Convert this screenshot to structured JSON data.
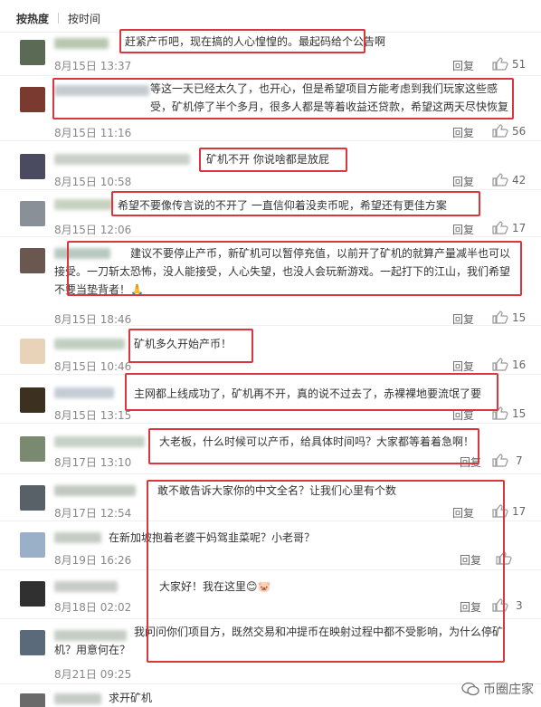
{
  "sort": {
    "hot": "按热度",
    "time": "按时间"
  },
  "reply_label": "回复",
  "comments": [
    {
      "text": "赶紧产币吧，现在搞的人心惶惶的。最起码给个公告啊",
      "time": "8月15日 13:37",
      "likes": "51"
    },
    {
      "text": "等这一天已经太久了，也开心，但是希望项目方能考虑到我们玩家这些感受，矿机停了半个多月，很多人都是等着收益还贷款，希望这两天尽快恢复矿机",
      "time": "8月15日 11:16",
      "likes": "56"
    },
    {
      "text": "矿机不开 你说啥都是放屁",
      "time": "8月15日 10:58",
      "likes": "42"
    },
    {
      "text": "希望不要像传言说的不开了 一直信仰着没卖币呢，希望还有更佳方案",
      "time": "8月15日 12:06",
      "likes": "17"
    },
    {
      "text": "建议不要停止产币，新矿机可以暂停充值，以前开了矿机的就算产量减半也可以接受。一刀斩太恐怖，没人能接受，人心失望，也没人会玩新游戏。一起打下的江山，我们希望不要当垫背者！🙏",
      "time": "8月15日 18:46",
      "likes": "15"
    },
    {
      "text": "矿机多久开始产币！",
      "time": "8月15日 10:46",
      "likes": "16"
    },
    {
      "text": "主网都上线成功了，矿机再不开，真的说不过去了，赤裸裸地要流氓了要",
      "time": "8月15日 13:15",
      "likes": "15"
    },
    {
      "text": "大老板，什么时候可以产币，给具体时间吗？大家都等着着急啊！",
      "time": "8月17日 13:10",
      "likes": "7"
    },
    {
      "text": "敢不敢告诉大家你的中文全名？让我们心里有个数",
      "time": "8月17日 12:54",
      "likes": "17"
    },
    {
      "text": "在新加坡抱着老婆干妈驾韭菜呢？小老哥？",
      "time": "8月19日 16:26",
      "likes": ""
    },
    {
      "text": "大家好！我在这里😊🐷",
      "time": "8月18日 02:02",
      "likes": "3"
    },
    {
      "text": "我问问你们项目方，既然交易和冲提币在映射过程中都不受影响，为什么停矿机？用意何在？",
      "time": "8月21日 09:25",
      "likes": ""
    },
    {
      "text": "求开矿机",
      "time": "",
      "likes": ""
    }
  ],
  "watermark": "币圈庄家",
  "colors": {
    "highlight": "#d9363e",
    "text": "#333333",
    "muted": "#888888"
  }
}
